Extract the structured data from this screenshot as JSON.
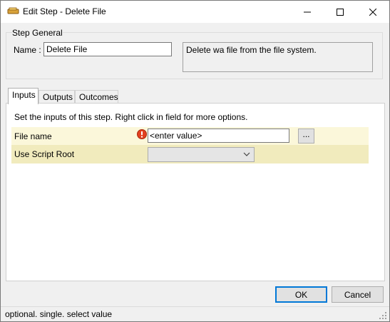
{
  "window": {
    "title": "Edit Step - Delete File",
    "minimize_symbol": "minimize",
    "maximize_symbol": "maximize",
    "close_symbol": "close"
  },
  "step_general": {
    "group_label": "Step General",
    "name_label": "Name :",
    "name_value": "Delete File",
    "description": "Delete wa file from the file system."
  },
  "tabs": [
    {
      "label": "Inputs",
      "active": true
    },
    {
      "label": "Outputs",
      "active": false
    },
    {
      "label": "Outcomes",
      "active": false
    }
  ],
  "inputs_panel": {
    "instructions": "Set the inputs of this step.  Right click in field for more options.",
    "rows": [
      {
        "label": "File name",
        "value": "<enter value>",
        "browse_label": "...",
        "icon": "error-icon"
      },
      {
        "label": "Use Script Root",
        "selected": ""
      }
    ]
  },
  "buttons": {
    "ok": "OK",
    "cancel": "Cancel"
  },
  "status": {
    "text": "optional. single. select value"
  },
  "colors": {
    "row_light": "#fbf7da",
    "row_dark": "#f1ebbd",
    "error": "#e3401f",
    "focus_border": "#0078d7"
  }
}
